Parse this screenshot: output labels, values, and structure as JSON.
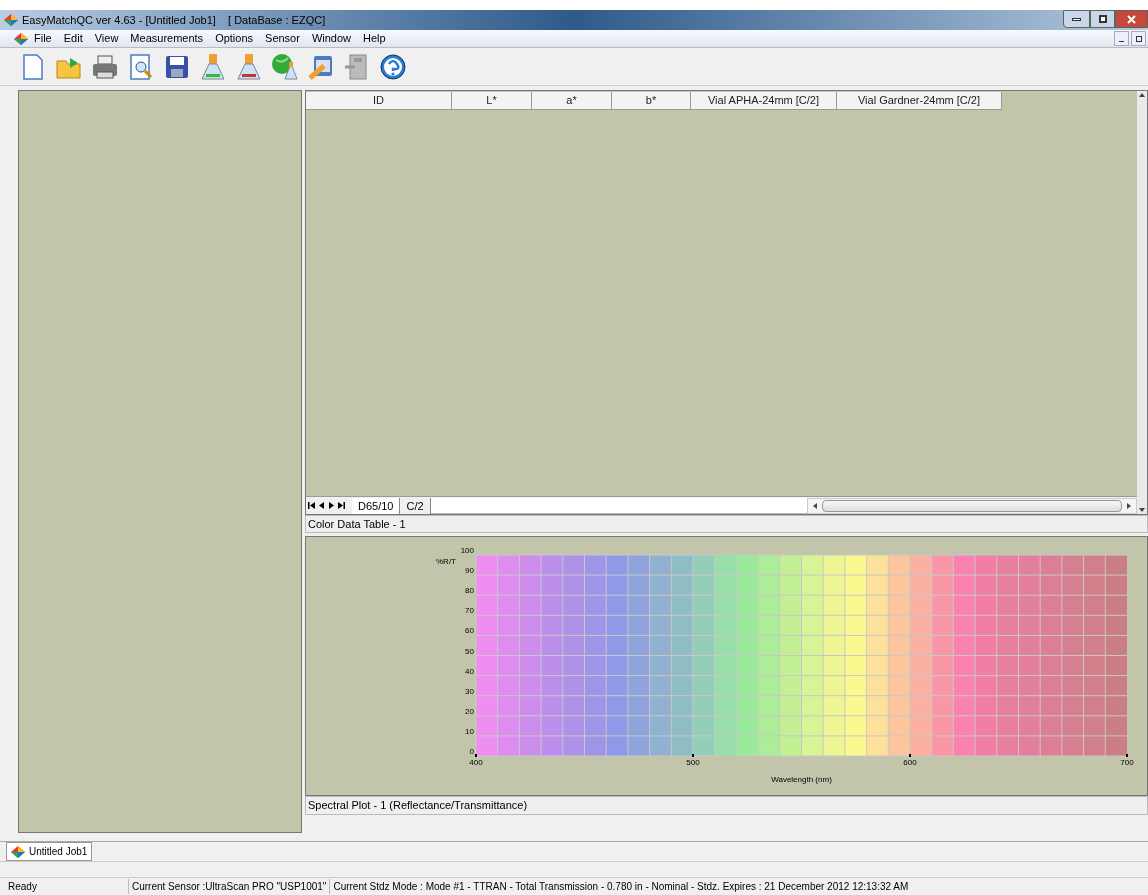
{
  "window": {
    "title": "EasyMatchQC ver 4.63 - [Untitled Job1]    [ DataBase : EZQC]"
  },
  "menu": [
    "File",
    "Edit",
    "View",
    "Measurements",
    "Options",
    "Sensor",
    "Window",
    "Help"
  ],
  "table": {
    "columns": [
      "ID",
      "L*",
      "a*",
      "b*",
      "Vial APHA-24mm [C/2]",
      "Vial Gardner-24mm [C/2]"
    ],
    "sheet_tabs": [
      {
        "label": "D65/10",
        "selected": true
      },
      {
        "label": "C/2",
        "selected": false
      }
    ],
    "caption": "Color Data Table - 1"
  },
  "plot": {
    "caption": "Spectral Plot - 1 (Reflectance/Transmittance)",
    "chart_data": {
      "type": "line",
      "grid": true,
      "xlabel": "Wavelength (nm)",
      "ylabel": "%R/T",
      "xlim": [
        400,
        700
      ],
      "ylim": [
        0,
        100
      ],
      "xticks": [
        400,
        500,
        600,
        700
      ],
      "yticks": [
        0,
        10,
        20,
        30,
        40,
        50,
        60,
        70,
        80,
        90,
        100
      ]
    }
  },
  "document_tabs": [
    {
      "label": "Untitled Job1",
      "selected": true
    }
  ],
  "status_bar": [
    "Ready",
    "Current Sensor :UltraScan PRO \"USP1001\"",
    "Current Stdz Mode : Mode #1 - TTRAN - Total Transmission - 0.780 in - Nominal - Stdz. Expires : 21 December 2012 12:13:32 AM"
  ]
}
